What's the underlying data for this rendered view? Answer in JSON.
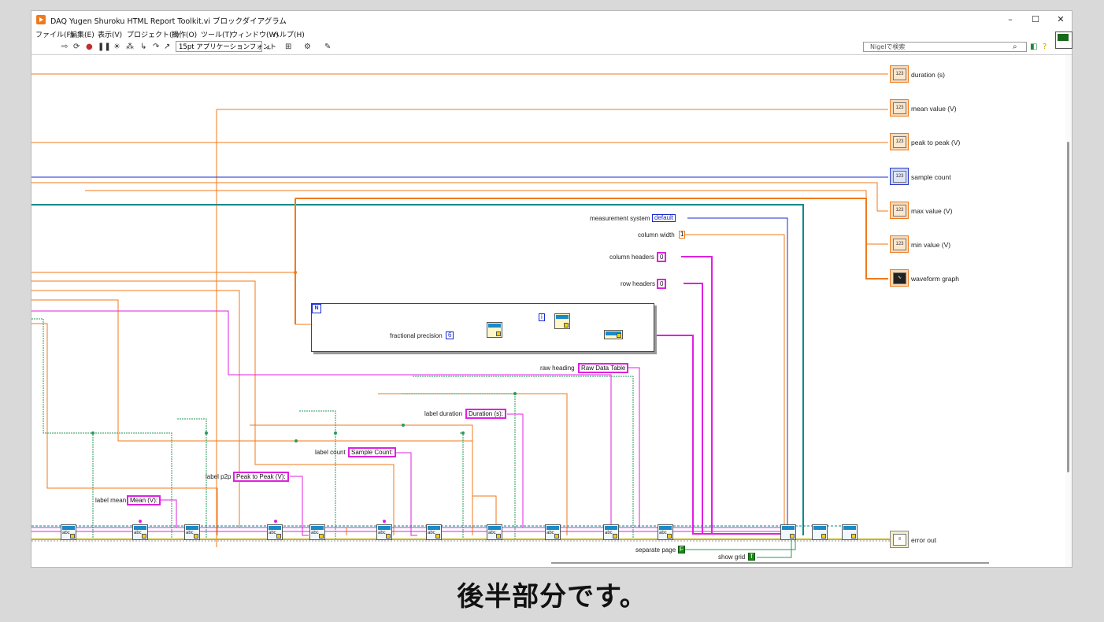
{
  "window": {
    "title": "DAQ Yugen Shuroku HTML Report Toolkit.vi ブロックダイアグラム",
    "controls": {
      "minimize": "–",
      "maximize": "☐",
      "close": "✕"
    }
  },
  "menu": [
    "ファイル(F)",
    "編集(E)",
    "表示(V)",
    "プロジェクト(P)",
    "操作(O)",
    "ツール(T)",
    "ウィンドウ(W)",
    "ヘルプ(H)"
  ],
  "toolbar": {
    "font_select": "15pt アプリケーションフォント",
    "search_placeholder": "Nigelで検索"
  },
  "indicators": [
    "duration (s)",
    "mean value (V)",
    "peak to peak (V)",
    "sample count",
    "max value (V)",
    "min value (V)",
    "waveform graph",
    "error out"
  ],
  "indicator_icon_text": {
    "numeric": "123"
  },
  "controls": {
    "measurement_system_label": "measurement system",
    "measurement_system_value": "default",
    "column_width_label": "column width",
    "column_width_value": "1",
    "column_headers_label": "column headers",
    "column_headers_value": "0",
    "row_headers_label": "row headers",
    "row_headers_value": "0",
    "fractional_precision_label": "fractional precision",
    "fractional_precision_value": "6",
    "loop_count": "N",
    "index_const": "i"
  },
  "string_constants": {
    "raw_heading_label": "raw heading",
    "raw_heading_value": "Raw Data Table",
    "label_duration_label": "label duration",
    "label_duration_value": "Duration (s):",
    "label_count_label": "label count",
    "label_count_value": "Sample Count:",
    "label_p2p_label": "label p2p",
    "label_p2p_value": "Peak to Peak (V):",
    "label_mean_label": "label mean",
    "label_mean_value": "Mean (V):"
  },
  "booleans": {
    "separate_page_label": "separate page",
    "separate_page_value": "F",
    "show_grid_label": "show grid",
    "show_grid_value": "T"
  },
  "subvi_text": "abc",
  "caption": "後半部分です。",
  "colors": {
    "orange_wire": "#f07a1a",
    "pink_wire": "#e020e0",
    "blue_wire": "#1a2ad0",
    "green_wire": "#2a9a5a",
    "teal_wire": "#0a8a8a",
    "error_wire": "#c8b400"
  }
}
